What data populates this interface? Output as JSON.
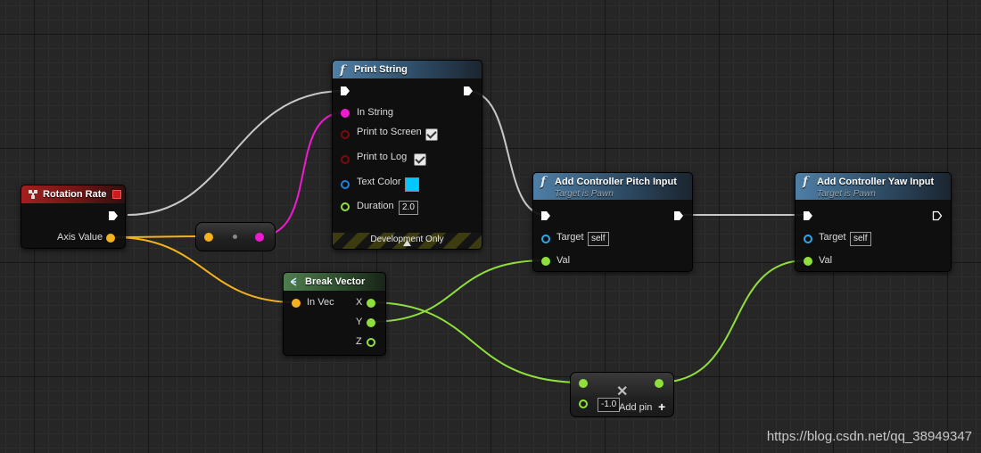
{
  "nodes": {
    "rotation_rate": {
      "title": "Rotation Rate",
      "pin_axis": "Axis Value"
    },
    "print_string": {
      "title": "Print String",
      "pin_in_string": "In String",
      "pin_print_screen": "Print to Screen",
      "pin_print_log": "Print to Log",
      "pin_text_color": "Text Color",
      "pin_duration": "Duration",
      "duration_value": "2.0",
      "footer": "Development Only",
      "text_color_hex": "#00c8ff"
    },
    "pitch": {
      "title": "Add Controller Pitch Input",
      "subtitle": "Target is Pawn",
      "pin_target": "Target",
      "target_value": "self",
      "pin_val": "Val"
    },
    "yaw": {
      "title": "Add Controller Yaw Input",
      "subtitle": "Target is Pawn",
      "pin_target": "Target",
      "target_value": "self",
      "pin_val": "Val"
    },
    "break_vector": {
      "title": "Break Vector",
      "pin_in": "In Vec",
      "pin_x": "X",
      "pin_y": "Y",
      "pin_z": "Z"
    },
    "multiply": {
      "value": "-1.0",
      "add_pin": "Add pin"
    }
  },
  "colors": {
    "exec_wire": "#c8c8c8",
    "float_wire": "#f5b21c",
    "string_wire": "#f01ad0",
    "vector_wire": "#8fe03a"
  },
  "watermark": "https://blog.csdn.net/qq_38949347"
}
